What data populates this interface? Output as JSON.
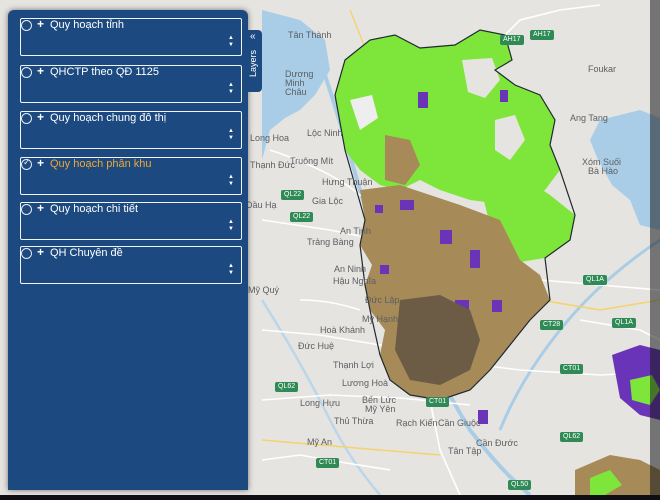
{
  "layers_panel": {
    "tab_label": "Layers",
    "collapse_icon": "«",
    "items": [
      {
        "label": "Quy hoạch tỉnh",
        "checked": false,
        "active": false
      },
      {
        "label": "QHCTP theo QĐ 1125",
        "checked": false,
        "active": false
      },
      {
        "label": "Quy hoạch chung đô thị",
        "checked": false,
        "active": false
      },
      {
        "label": "Quy hoạch phân khu",
        "checked": true,
        "active": true
      },
      {
        "label": "Quy hoạch chi tiết",
        "checked": false,
        "active": false
      },
      {
        "label": "QH Chuyên đề",
        "checked": false,
        "active": false
      }
    ],
    "plus_symbol": "+",
    "stepper_up": "▲",
    "stepper_down": "▼",
    "colors": {
      "panel": "#1c4a80",
      "active_text": "#f0a732"
    }
  },
  "map": {
    "place_labels": [
      "Tân Thành",
      "Dương Minh Châu",
      "Lộc Ninh",
      "Long Hoa",
      "Thạnh Đức",
      "Truông Mít",
      "Hưng Thuận",
      "Gia Lộc",
      "Dầu Hạ",
      "An Tịnh",
      "Trảng Bàng",
      "An Ninh",
      "Mỹ Quý",
      "Hậu Nghĩa",
      "Đức Lập",
      "Mỹ Hạnh",
      "Hoà Khánh",
      "Đức Huệ",
      "Thạnh Lợi",
      "Lương Hoà",
      "Bến Lức",
      "Long Hựu",
      "Thủ Thừa",
      "Mỹ Yên",
      "Rạch Kiến",
      "Cần Giuộc",
      "Mỹ An",
      "Tân Tập",
      "Foukar",
      "Ang Tang",
      "Xóm Suối",
      "Bà Hào",
      "Cần Đước"
    ],
    "road_labels": [
      "AH17",
      "AH17",
      "QL22",
      "QL22",
      "QL1A",
      "CT28",
      "CT01",
      "CT01",
      "CT01",
      "QL62",
      "QL62",
      "QL1A",
      "QL50"
    ],
    "colors": {
      "base": "#e6e4e0",
      "water": "#a9cde6",
      "green": "#7ee63a",
      "brown": "#a68a58",
      "purple": "#6a34b8"
    }
  }
}
